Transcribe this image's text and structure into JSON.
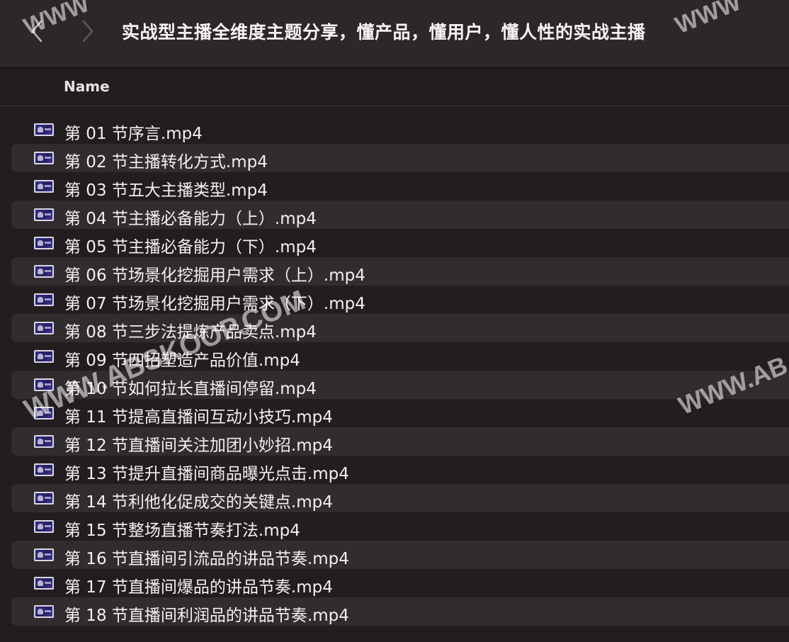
{
  "toolbar": {
    "title": "实战型主播全维度主题分享，懂产品，懂用户，懂人性的实战主播"
  },
  "header": {
    "name_column": "Name"
  },
  "files": [
    "第 01 节序言.mp4",
    "第 02 节主播转化方式.mp4",
    "第 03 节五大主播类型.mp4",
    "第 04 节主播必备能力（上）.mp4",
    "第 05 节主播必备能力（下）.mp4",
    "第 06 节场景化挖掘用户需求（上）.mp4",
    "第 07 节场景化挖掘用户需求（下）.mp4",
    "第 08 节三步法提炼产品卖点.mp4",
    "第 09 节四招塑造产品价值.mp4",
    "第 10 节如何拉长直播间停留.mp4",
    "第 11 节提高直播间互动小技巧.mp4",
    "第 12 节直播间关注加团小妙招.mp4",
    "第 13 节提升直播间商品曝光点击.mp4",
    "第 14 节利他化促成交的关键点.mp4",
    "第 15 节整场直播节奏打法.mp4",
    "第 16 节直播间引流品的讲品节奏.mp4",
    "第 17 节直播间爆品的讲品节奏.mp4",
    "第 18 节直播间利润品的讲品节奏.mp4"
  ],
  "watermarks": {
    "main": "WWW.ABSKOOP.COM",
    "right": "WWW.AB",
    "top_left": "WWW",
    "top_right": "WWW"
  },
  "icons": {
    "back": "chevron-left-icon",
    "forward": "chevron-right-icon",
    "file": "video-thumbnail-icon"
  },
  "colors": {
    "background": "#221e1f",
    "toolbar": "#2c2728",
    "row_alt": "#312c2d",
    "text": "#f4f0f0"
  }
}
